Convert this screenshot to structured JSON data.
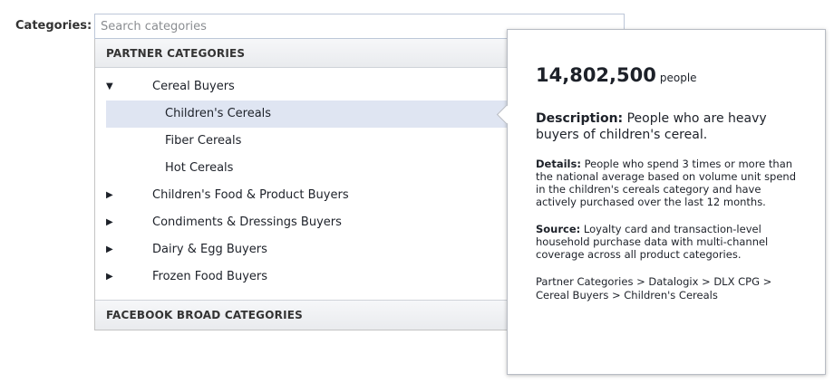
{
  "field": {
    "label": "Categories:",
    "placeholder": "Search categories"
  },
  "sections": {
    "partner": "PARTNER CATEGORIES",
    "facebook": "FACEBOOK BROAD CATEGORIES"
  },
  "tree": {
    "expanded_arrow": "▼",
    "collapsed_arrow": "▶",
    "cereal_buyers": "Cereal Buyers",
    "children": [
      "Children's Cereals",
      "Fiber Cereals",
      "Hot Cereals"
    ],
    "groups": [
      "Children's Food & Product Buyers",
      "Condiments & Dressings Buyers",
      "Dairy & Egg Buyers",
      "Frozen Food Buyers"
    ],
    "info_icon": "i"
  },
  "popover": {
    "count": "14,802,500",
    "count_unit": "people",
    "description_label": "Description:",
    "description_text": "People who are heavy buyers of children's cereal.",
    "details_label": "Details:",
    "details_text": "People who spend 3 times or more than the national average based on volume unit spend in the children's cereals category and have actively purchased over the last 12 months.",
    "source_label": "Source:",
    "source_text": "Loyalty card and transaction-level household purchase data with multi-channel coverage across all product categories.",
    "path": "Partner Categories > Datalogix > DLX CPG > Cereal Buyers > Children's Cereals"
  },
  "colors": {
    "selected_row": "#dfe5f2",
    "info_icon": "#8a9cc8"
  }
}
